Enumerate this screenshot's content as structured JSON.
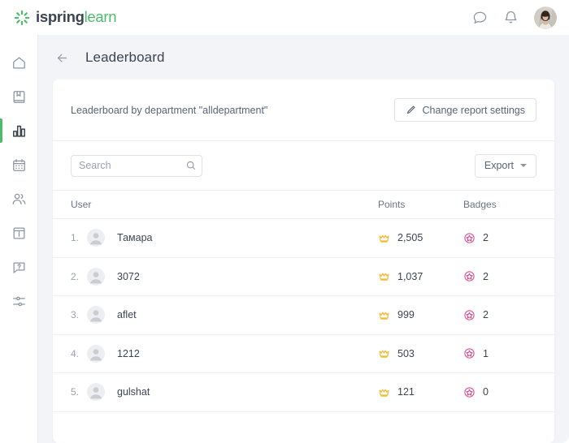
{
  "brand": {
    "logo_icon": "ispring-starburst-icon",
    "name_bold": "ispring",
    "name_light": "learn",
    "accent_green": "#4cbb6c",
    "text_dark": "#3c4452"
  },
  "topbar": {
    "icons": [
      {
        "name": "chat-icon",
        "glyph": "speech-bubble"
      },
      {
        "name": "notifications-icon",
        "glyph": "bell"
      }
    ],
    "avatar_alt": "user-avatar"
  },
  "sidebar": {
    "items": [
      {
        "name": "home",
        "icon": "home-icon",
        "active": false
      },
      {
        "name": "courses",
        "icon": "book-icon",
        "active": false
      },
      {
        "name": "reports",
        "icon": "bar-chart-icon",
        "active": true
      },
      {
        "name": "calendar",
        "icon": "calendar-icon",
        "active": false
      },
      {
        "name": "users",
        "icon": "people-icon",
        "active": false
      },
      {
        "name": "news",
        "icon": "news-panel-icon",
        "active": false
      },
      {
        "name": "help",
        "icon": "question-bubble-icon",
        "active": false
      },
      {
        "name": "settings",
        "icon": "sliders-icon",
        "active": false
      }
    ]
  },
  "page": {
    "back_icon": "back-arrow-icon",
    "title": "Leaderboard"
  },
  "report": {
    "description": "Leaderboard by department \"alldepartment\"",
    "settings_button": {
      "label": "Change report settings",
      "icon": "pencil-icon"
    }
  },
  "toolbar": {
    "search": {
      "value": "",
      "placeholder": "Search",
      "icon": "search-icon"
    },
    "export": {
      "label": "Export",
      "icon": "chevron-down-icon"
    }
  },
  "table": {
    "columns": {
      "user": "User",
      "points": "Points",
      "badges": "Badges"
    },
    "points_icon": "crown-icon",
    "badges_icon": "badge-star-icon",
    "points_icon_color": "#f5b82e",
    "badges_icon_color": "#d8458c",
    "rows": [
      {
        "rank": "1.",
        "user": "Тамара",
        "points": "2,505",
        "badges": "2"
      },
      {
        "rank": "2.",
        "user": "3072",
        "points": "1,037",
        "badges": "2"
      },
      {
        "rank": "3.",
        "user": "aflet",
        "points": "999",
        "badges": "2"
      },
      {
        "rank": "4.",
        "user": "1212",
        "points": "503",
        "badges": "1"
      },
      {
        "rank": "5.",
        "user": "gulshat",
        "points": "121",
        "badges": "0"
      }
    ]
  }
}
